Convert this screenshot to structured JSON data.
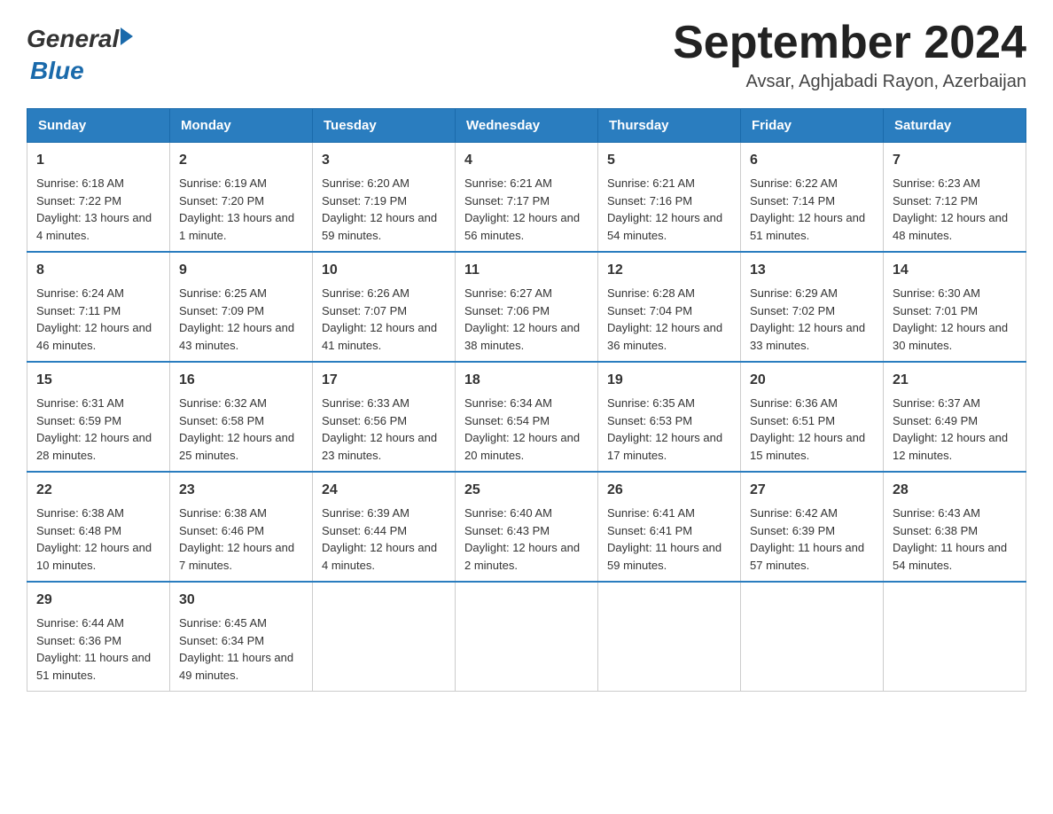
{
  "logo": {
    "text_general": "General",
    "text_blue": "Blue",
    "arrow_color": "#1a6aab"
  },
  "title": {
    "month_year": "September 2024",
    "location": "Avsar, Aghjabadi Rayon, Azerbaijan"
  },
  "headers": [
    "Sunday",
    "Monday",
    "Tuesday",
    "Wednesday",
    "Thursday",
    "Friday",
    "Saturday"
  ],
  "weeks": [
    [
      {
        "day": "1",
        "sunrise": "6:18 AM",
        "sunset": "7:22 PM",
        "daylight": "13 hours and 4 minutes."
      },
      {
        "day": "2",
        "sunrise": "6:19 AM",
        "sunset": "7:20 PM",
        "daylight": "13 hours and 1 minute."
      },
      {
        "day": "3",
        "sunrise": "6:20 AM",
        "sunset": "7:19 PM",
        "daylight": "12 hours and 59 minutes."
      },
      {
        "day": "4",
        "sunrise": "6:21 AM",
        "sunset": "7:17 PM",
        "daylight": "12 hours and 56 minutes."
      },
      {
        "day": "5",
        "sunrise": "6:21 AM",
        "sunset": "7:16 PM",
        "daylight": "12 hours and 54 minutes."
      },
      {
        "day": "6",
        "sunrise": "6:22 AM",
        "sunset": "7:14 PM",
        "daylight": "12 hours and 51 minutes."
      },
      {
        "day": "7",
        "sunrise": "6:23 AM",
        "sunset": "7:12 PM",
        "daylight": "12 hours and 48 minutes."
      }
    ],
    [
      {
        "day": "8",
        "sunrise": "6:24 AM",
        "sunset": "7:11 PM",
        "daylight": "12 hours and 46 minutes."
      },
      {
        "day": "9",
        "sunrise": "6:25 AM",
        "sunset": "7:09 PM",
        "daylight": "12 hours and 43 minutes."
      },
      {
        "day": "10",
        "sunrise": "6:26 AM",
        "sunset": "7:07 PM",
        "daylight": "12 hours and 41 minutes."
      },
      {
        "day": "11",
        "sunrise": "6:27 AM",
        "sunset": "7:06 PM",
        "daylight": "12 hours and 38 minutes."
      },
      {
        "day": "12",
        "sunrise": "6:28 AM",
        "sunset": "7:04 PM",
        "daylight": "12 hours and 36 minutes."
      },
      {
        "day": "13",
        "sunrise": "6:29 AM",
        "sunset": "7:02 PM",
        "daylight": "12 hours and 33 minutes."
      },
      {
        "day": "14",
        "sunrise": "6:30 AM",
        "sunset": "7:01 PM",
        "daylight": "12 hours and 30 minutes."
      }
    ],
    [
      {
        "day": "15",
        "sunrise": "6:31 AM",
        "sunset": "6:59 PM",
        "daylight": "12 hours and 28 minutes."
      },
      {
        "day": "16",
        "sunrise": "6:32 AM",
        "sunset": "6:58 PM",
        "daylight": "12 hours and 25 minutes."
      },
      {
        "day": "17",
        "sunrise": "6:33 AM",
        "sunset": "6:56 PM",
        "daylight": "12 hours and 23 minutes."
      },
      {
        "day": "18",
        "sunrise": "6:34 AM",
        "sunset": "6:54 PM",
        "daylight": "12 hours and 20 minutes."
      },
      {
        "day": "19",
        "sunrise": "6:35 AM",
        "sunset": "6:53 PM",
        "daylight": "12 hours and 17 minutes."
      },
      {
        "day": "20",
        "sunrise": "6:36 AM",
        "sunset": "6:51 PM",
        "daylight": "12 hours and 15 minutes."
      },
      {
        "day": "21",
        "sunrise": "6:37 AM",
        "sunset": "6:49 PM",
        "daylight": "12 hours and 12 minutes."
      }
    ],
    [
      {
        "day": "22",
        "sunrise": "6:38 AM",
        "sunset": "6:48 PM",
        "daylight": "12 hours and 10 minutes."
      },
      {
        "day": "23",
        "sunrise": "6:38 AM",
        "sunset": "6:46 PM",
        "daylight": "12 hours and 7 minutes."
      },
      {
        "day": "24",
        "sunrise": "6:39 AM",
        "sunset": "6:44 PM",
        "daylight": "12 hours and 4 minutes."
      },
      {
        "day": "25",
        "sunrise": "6:40 AM",
        "sunset": "6:43 PM",
        "daylight": "12 hours and 2 minutes."
      },
      {
        "day": "26",
        "sunrise": "6:41 AM",
        "sunset": "6:41 PM",
        "daylight": "11 hours and 59 minutes."
      },
      {
        "day": "27",
        "sunrise": "6:42 AM",
        "sunset": "6:39 PM",
        "daylight": "11 hours and 57 minutes."
      },
      {
        "day": "28",
        "sunrise": "6:43 AM",
        "sunset": "6:38 PM",
        "daylight": "11 hours and 54 minutes."
      }
    ],
    [
      {
        "day": "29",
        "sunrise": "6:44 AM",
        "sunset": "6:36 PM",
        "daylight": "11 hours and 51 minutes."
      },
      {
        "day": "30",
        "sunrise": "6:45 AM",
        "sunset": "6:34 PM",
        "daylight": "11 hours and 49 minutes."
      },
      null,
      null,
      null,
      null,
      null
    ]
  ],
  "labels": {
    "sunrise": "Sunrise:",
    "sunset": "Sunset:",
    "daylight": "Daylight:"
  }
}
